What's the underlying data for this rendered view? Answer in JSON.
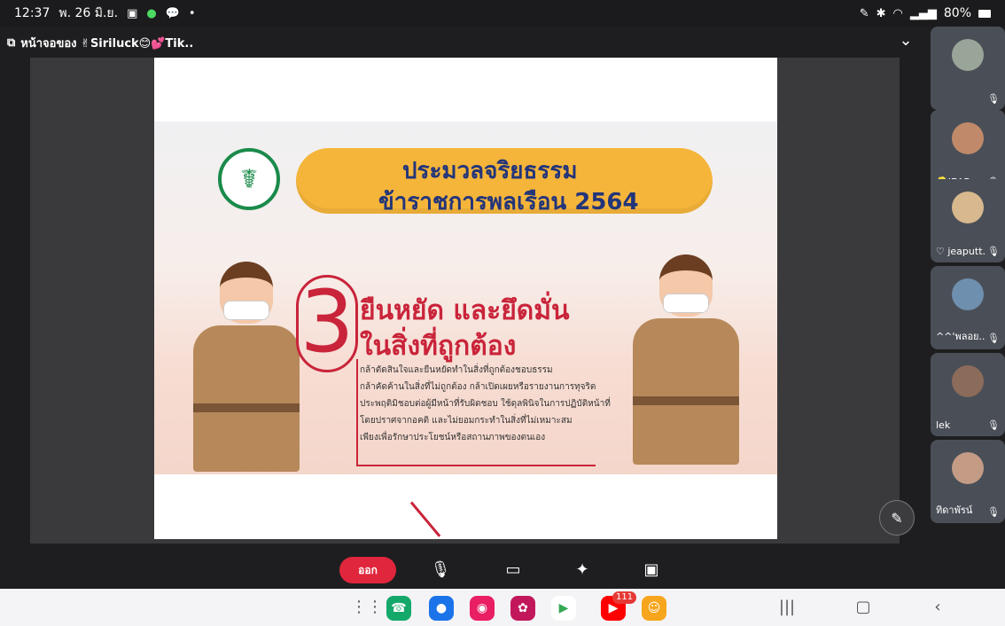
{
  "status_bar": {
    "time": "12:37",
    "date": "พ. 26 มิ.ย.",
    "battery": "80%"
  },
  "meet": {
    "share_title": "หน้าจอของ ✌Siriluck😊💕Tik..",
    "slide": {
      "banner_line1": "ประมวลจริยธรรม",
      "banner_line2": "ข้าราชการพลเรือน 2564",
      "number": "3",
      "headline_line1": "ยืนหยัด และยึดมั่น",
      "headline_line2": "ในสิ่งที่ถูกต้อง",
      "body_lines": [
        "กล้าตัดสินใจและยืนหยัดทำในสิ่งที่ถูกต้องชอบธรรม",
        "กล้าคัดค้านในสิ่งที่ไม่ถูกต้อง กล้าเปิดเผยหรือรายงานการทุจริต",
        "ประพฤติมิชอบต่อผู้มีหน้าที่รับผิดชอบ ใช้ดุลพินิจในการปฏิบัติหน้าที่",
        "โดยปราศจากอคติ และไม่ยอมกระทำในสิ่งที่ไม่เหมาะสม",
        "เพียงเพื่อรักษาประโยชน์หรือสถานภาพของตนเอง"
      ]
    },
    "participants": [
      {
        "name": ""
      },
      {
        "name": "👱JEAB..."
      },
      {
        "name": "♡ jeaputt..."
      },
      {
        "name": "^^'พลอย..."
      },
      {
        "name": "lek"
      },
      {
        "name": "ทิดาพัรน์"
      }
    ],
    "controls": {
      "leave_label": "ออก"
    }
  },
  "nav": {
    "youtube_badge": "111"
  }
}
